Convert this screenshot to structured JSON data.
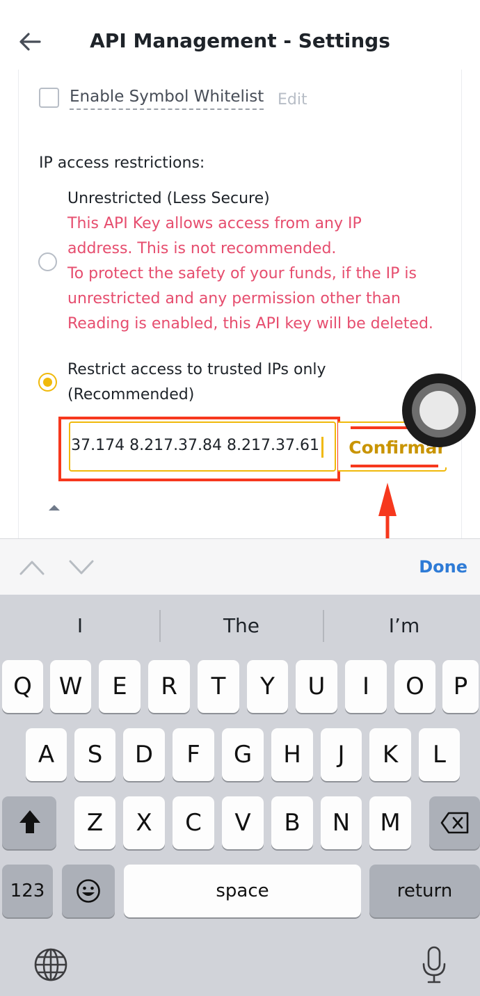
{
  "header": {
    "title": "API Management - Settings",
    "back_icon": "arrow-left-icon"
  },
  "whitelist": {
    "label": "Enable Symbol Whitelist",
    "edit_label": "Edit",
    "checked": false
  },
  "ip": {
    "heading": "IP access restrictions:",
    "unrestricted": {
      "title": "Unrestricted (Less Secure)",
      "warning_lines": [
        "This API Key allows access from any IP",
        "address. This is not recommended.",
        "To protect the safety of your funds, if the IP is",
        "unrestricted and any permission other than",
        "Reading is enabled, this API key will be deleted."
      ],
      "selected": false
    },
    "restricted": {
      "title_line1": "Restrict access to trusted IPs only",
      "title_line2": "(Recommended)",
      "selected": true
    },
    "input_value": "37.174 8.217.37.84 8.217.37.61",
    "confirm_label": "Confirmar"
  },
  "toolbar": {
    "done_label": "Done"
  },
  "keyboard": {
    "suggestions": [
      "I",
      "The",
      "I’m"
    ],
    "row1": [
      "Q",
      "W",
      "E",
      "R",
      "T",
      "Y",
      "U",
      "I",
      "O",
      "P"
    ],
    "row2": [
      "A",
      "S",
      "D",
      "F",
      "G",
      "H",
      "J",
      "K",
      "L"
    ],
    "row3": [
      "Z",
      "X",
      "C",
      "V",
      "B",
      "N",
      "M"
    ],
    "numbers_label": "123",
    "space_label": "space",
    "return_label": "return"
  },
  "colors": {
    "accent": "#f0b90b",
    "warning": "#e64d6e",
    "annotation": "#f6381d",
    "link": "#2e7bd6"
  }
}
